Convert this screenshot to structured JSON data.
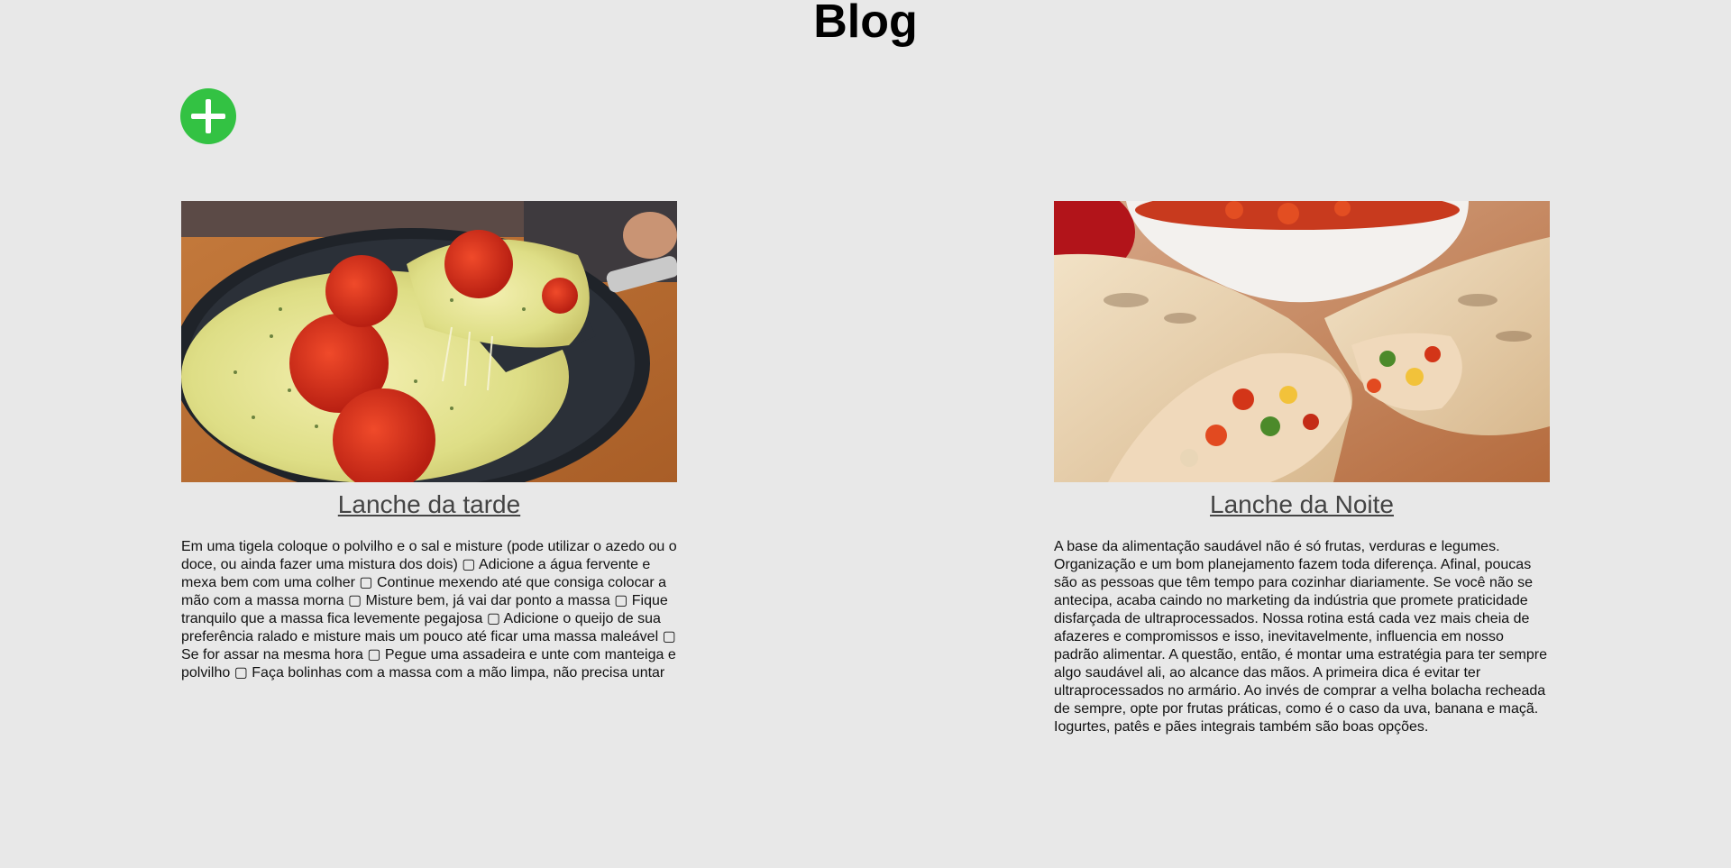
{
  "page": {
    "title": "Blog"
  },
  "toolbar": {
    "add_icon": "plus-icon",
    "add_color": "#33c243"
  },
  "posts": [
    {
      "title": "Lanche da tarde",
      "text": "Em uma tigela coloque o polvilho e o sal e misture (pode utilizar o azedo ou o doce, ou ainda fazer uma mistura dos dois) ▢ Adicione a água fervente e mexa bem com uma colher ▢ Continue mexendo até que consiga colocar a mão com a massa morna ▢ Misture bem, já vai dar ponto a massa ▢ Fique tranquilo que a massa fica levemente pegajosa ▢ Adicione o queijo de sua preferência ralado e misture mais um pouco até ficar uma massa maleável ▢ Se for assar na mesma hora ▢ Pegue uma assadeira e unte com manteiga e polvilho ▢ Faça bolinhas com a massa com a mão limpa, não precisa untar"
    },
    {
      "title": "Lanche da Noite",
      "text": "A base da alimentação saudável não é só frutas, verduras e legumes. Organização e um bom planejamento fazem toda diferença. Afinal, poucas são as pessoas que têm tempo para cozinhar diariamente. Se você não se antecipa, acaba caindo no marketing da indústria que promete praticidade disfarçada de ultraprocessados. Nossa rotina está cada vez mais cheia de afazeres e compromissos e isso, inevitavelmente, influencia em nosso padrão alimentar. A questão, então, é montar uma estratégia para ter sempre algo saudável ali, ao alcance das mãos. A primeira dica é evitar ter ultraprocessados no armário. Ao invés de comprar a velha bolacha recheada de sempre, opte por frutas práticas, como é o caso da uva, banana e maçã. Iogurtes, patês e pães integrais também são boas opções."
    }
  ]
}
